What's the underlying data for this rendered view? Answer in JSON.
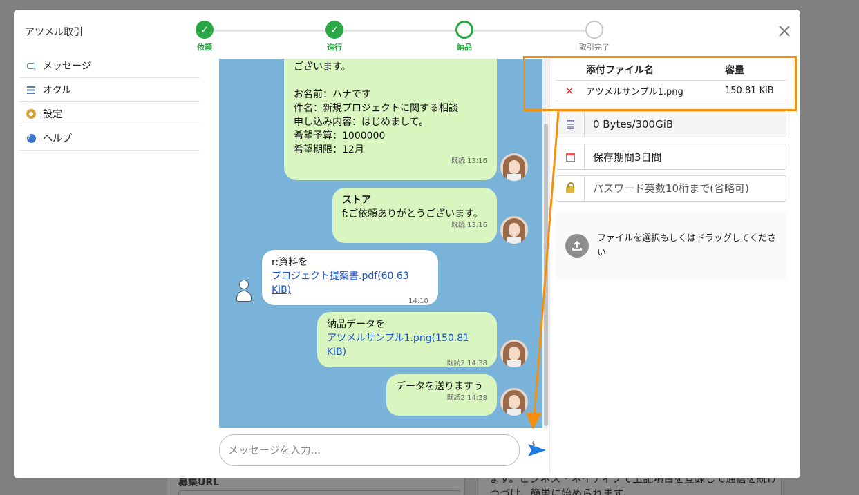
{
  "background": {
    "left_label": "募集URL",
    "right_text": "ます。ビジネス・ネイティブで上記項目を登録して通信を続けつづけ。簡単に始められます。"
  },
  "modal": {
    "title": "アツメル取引"
  },
  "stepper": [
    {
      "label": "依頼",
      "state": "done",
      "mark": "✓"
    },
    {
      "label": "進行",
      "state": "done",
      "mark": "✓"
    },
    {
      "label": "納品",
      "state": "current",
      "mark": ""
    },
    {
      "label": "取引完了",
      "state": "todo",
      "mark": ""
    }
  ],
  "sidebar": {
    "items": [
      {
        "label": "メッセージ",
        "icon": "message-icon"
      },
      {
        "label": "オクル",
        "icon": "list-icon"
      },
      {
        "label": "設定",
        "icon": "gear-icon"
      },
      {
        "label": "ヘルプ",
        "icon": "help-icon"
      }
    ]
  },
  "chat": {
    "messages": [
      {
        "side": "mine",
        "lines_top": "ございます。",
        "lines": [
          "お名前：ハナです",
          "件名：新規プロジェクトに関する相談",
          "申し込み内容：はじめまして。",
          "希望予算：1000000",
          "希望期限：12月"
        ],
        "meta": "既読 13:16"
      },
      {
        "side": "mine",
        "sender": "ストア",
        "text": "f:ご依頼ありがとうございます。",
        "meta": "既読 13:16"
      },
      {
        "side": "theirs",
        "text": "r:資料を",
        "link": "プロジェクト提案書.pdf(60.63 KiB)",
        "meta": "14:10"
      },
      {
        "side": "mine",
        "text": "納品データを",
        "link": "アツメルサンプル1.png(150.81 KiB)",
        "meta": "既読2 14:38"
      },
      {
        "side": "mine",
        "text": "データを送りますう",
        "meta": "既読2 14:38"
      }
    ],
    "input_placeholder": "メッセージを入力..."
  },
  "attachments": {
    "header_name": "添付ファイル名",
    "header_size": "容量",
    "rows": [
      {
        "name": "アツメルサンプル1.png",
        "size": "150.81 KiB"
      }
    ]
  },
  "storage": {
    "usage": "0 Bytes/300GiB",
    "retention": "保存期間3日間",
    "password_placeholder": "パスワード英数10桁まで(省略可)"
  },
  "dropzone": {
    "text": "ファイルを選択もしくはドラッグしてください"
  },
  "colors": {
    "accent_green": "#29a745",
    "chat_bg": "#7ab3da",
    "bubble_mine": "#d9f6c1",
    "annotation_orange": "#f5900f",
    "link_blue": "#1a55d8"
  }
}
